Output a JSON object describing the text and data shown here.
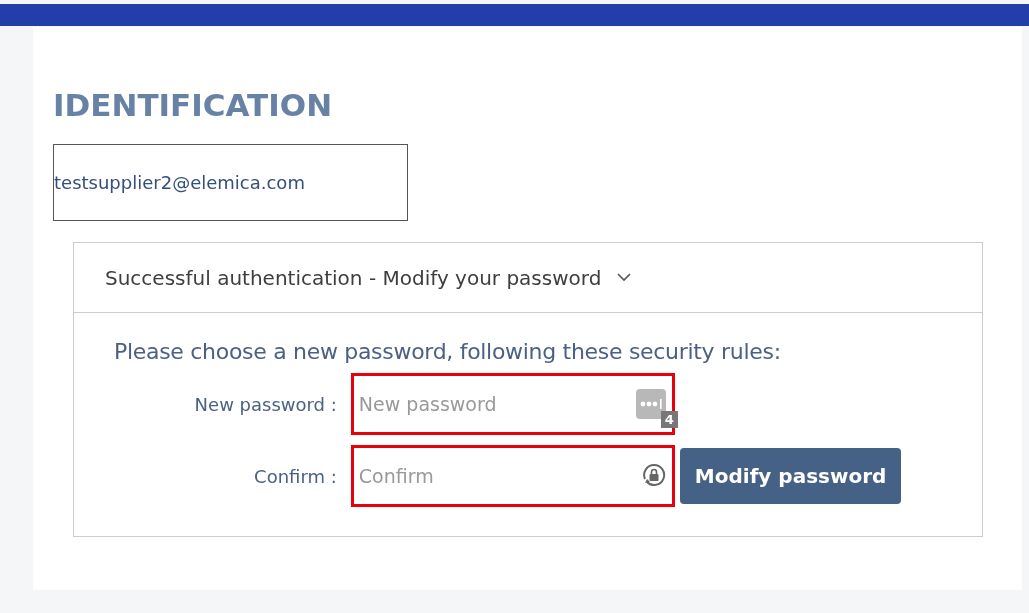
{
  "heading": "IDENTIFICATION",
  "email": "testsupplier2@elemica.com",
  "panel": {
    "title": "Successful authentication - Modify your password",
    "expanded": true,
    "instruction": "Please choose a new password, following these security rules:",
    "fields": [
      {
        "label": "New password :",
        "placeholder": "New password",
        "invalid": true,
        "kind": "generate",
        "badge": "4"
      },
      {
        "label": "Confirm :",
        "placeholder": "Confirm",
        "invalid": true,
        "kind": "lock"
      }
    ],
    "button": "Modify password"
  }
}
